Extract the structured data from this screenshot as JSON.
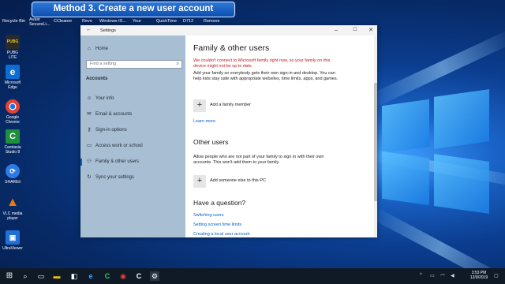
{
  "banner": {
    "text": "Method 3. Create a new user account"
  },
  "desktop": {
    "top_labels": [
      "Recycle Bin",
      "Avast\nSecureLi...",
      "CCleaner",
      "Revo",
      "Windows-IS...",
      "Your",
      "QuickTime",
      "D712",
      "Remove"
    ],
    "icons": [
      {
        "label": "PUBG LITE",
        "icon": "pubg-icon",
        "color": "#2b2b2b"
      },
      {
        "label": "Microsoft Edge",
        "icon": "edge-icon",
        "color": "#0c6ed4"
      },
      {
        "label": "Google Chrome",
        "icon": "chrome-icon",
        "color": "#e4e4e4"
      },
      {
        "label": "Camtasia Studio 8",
        "icon": "camtasia-icon",
        "color": "#1e8f3a"
      },
      {
        "label": "SHAREit",
        "icon": "shareit-icon",
        "color": "#2c7be5"
      },
      {
        "label": "VLC media player",
        "icon": "vlc-icon",
        "color": "#f07a12"
      },
      {
        "label": "UltraViewer",
        "icon": "ultraviewer-icon",
        "color": "#1f6fd6"
      }
    ]
  },
  "window": {
    "title": "Settings",
    "sidebar": {
      "home": "Home",
      "search_placeholder": "Find a setting",
      "section": "Accounts",
      "items": [
        {
          "label": "Your info",
          "icon": "person-icon"
        },
        {
          "label": "Email & accounts",
          "icon": "mail-icon"
        },
        {
          "label": "Sign-in options",
          "icon": "key-icon"
        },
        {
          "label": "Access work or school",
          "icon": "briefcase-icon"
        },
        {
          "label": "Family & other users",
          "icon": "people-icon"
        },
        {
          "label": "Sync your settings",
          "icon": "sync-icon"
        }
      ]
    },
    "content": {
      "title": "Family & other users",
      "warning": "We couldn't connect to Microsoft family right now, so your family on this device might not be up to date.",
      "family_desc": "Add your family so everybody gets their own sign-in and desktop. You can help kids stay safe with appropriate websites, time limits, apps, and games.",
      "add_family": "Add a family member",
      "learn_more": "Learn more",
      "other_users_title": "Other users",
      "other_desc": "Allow people who are not part of your family to sign in with their own accounts. This won't add them to your family.",
      "add_other": "Add someone else to this PC",
      "question_title": "Have a question?",
      "links": [
        "Switching users",
        "Setting screen time limits",
        "Creating a local user account"
      ]
    }
  },
  "taskbar": {
    "time": "3:53 PM",
    "date": "12/9/2019"
  }
}
